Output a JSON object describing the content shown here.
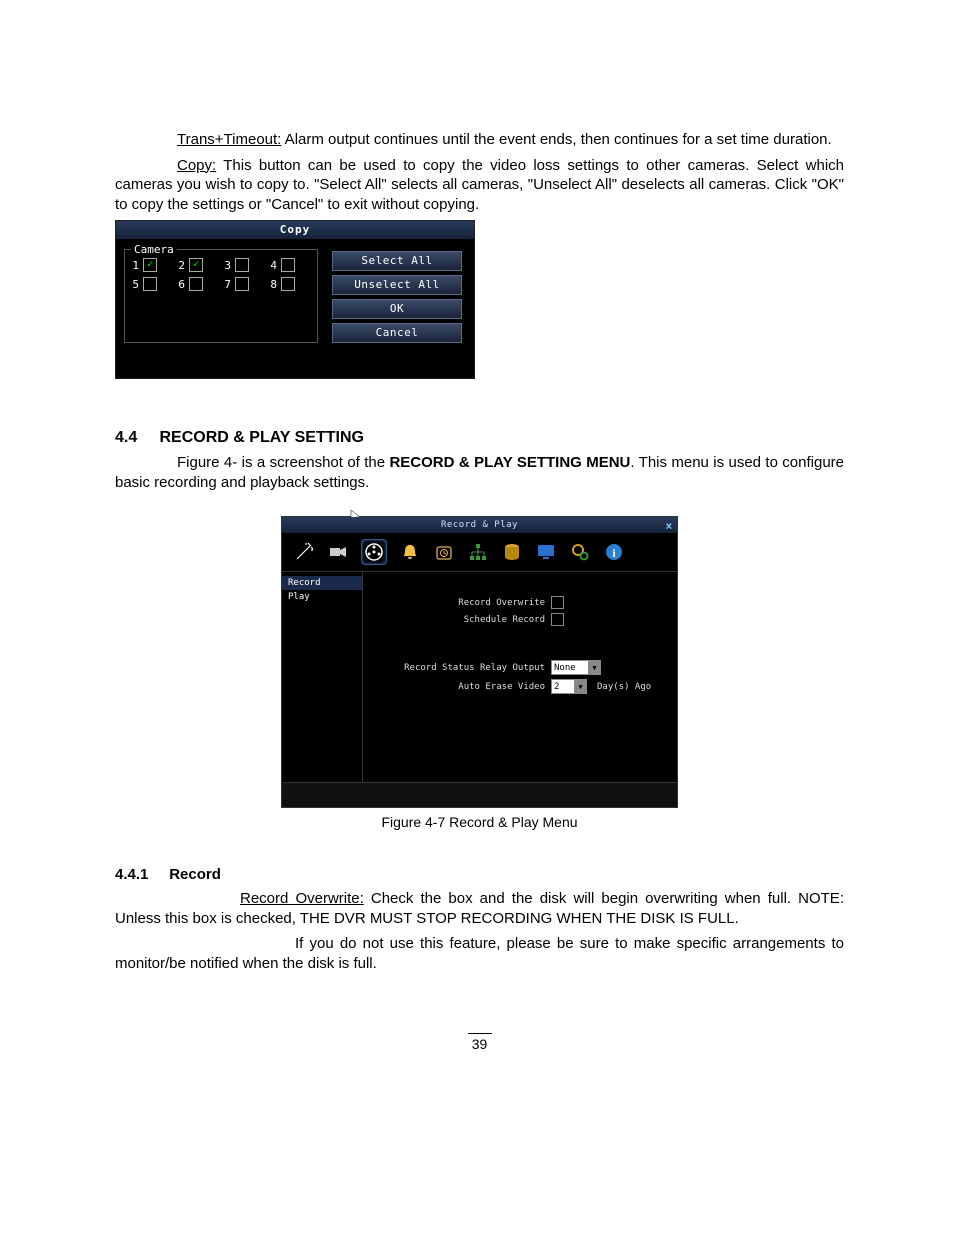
{
  "p1": {
    "label": "Trans+Timeout:",
    "text": " Alarm output continues until the event ends, then continues for a set time duration."
  },
  "p2": {
    "label": "Copy:",
    "text": " This button can be used to copy the video loss settings to other cameras. Select which cameras you wish to copy to. \"Select All\" selects all cameras, \"Unselect All\" deselects all cameras. Click \"OK\" to copy the settings or \"Cancel\" to exit without copying."
  },
  "copy_dialog": {
    "title": "Copy",
    "fieldset": "Camera",
    "cams": [
      "1",
      "2",
      "3",
      "4",
      "5",
      "6",
      "7",
      "8"
    ],
    "checked": {
      "1": true,
      "2": true,
      "3": false,
      "4": false,
      "5": false,
      "6": false,
      "7": false,
      "8": false
    },
    "buttons": {
      "select_all": "Select All",
      "unselect_all": "Unselect All",
      "ok": "OK",
      "cancel": "Cancel"
    }
  },
  "section": {
    "num": "4.4",
    "title": "RECORD & PLAY SETTING"
  },
  "p3a": "Figure 4- is a screenshot of the ",
  "p3b": "RECORD & PLAY SETTING MENU",
  "p3c": ". This menu is used to configure basic recording and playback settings.",
  "rp": {
    "title": "Record & Play",
    "sidebar": {
      "record": "Record",
      "play": "Play"
    },
    "fields": {
      "overwrite": "Record Overwrite",
      "schedule": "Schedule Record",
      "relay": "Record Status Relay Output",
      "relay_val": "None",
      "erase": "Auto Erase Video",
      "erase_val": "2",
      "erase_suffix": "Day(s) Ago"
    }
  },
  "fig_caption": "Figure 4-7  Record & Play Menu",
  "subsection": {
    "num": "4.4.1",
    "title": "Record"
  },
  "p4": {
    "label": "Record Overwrite:",
    "text": " Check the box and the disk will begin overwriting when full. NOTE: Unless this box is checked, THE DVR MUST STOP RECORDING WHEN THE DISK IS FULL."
  },
  "p5": "If you do not use this feature, please be sure to make specific arrangements to monitor/be notified when the disk is full.",
  "page_num": "39"
}
